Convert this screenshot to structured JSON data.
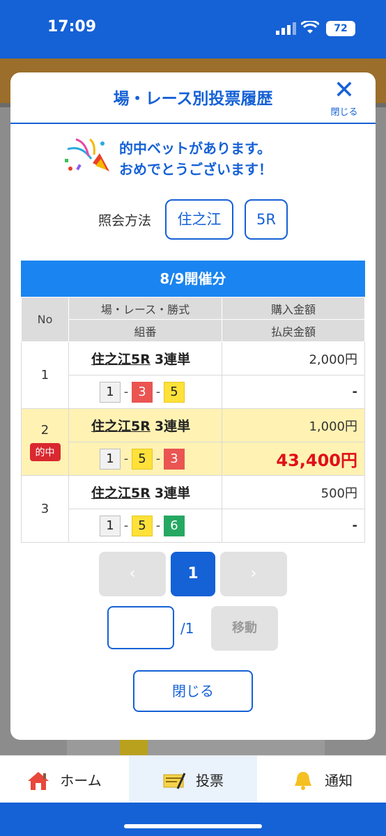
{
  "status_bar": {
    "time": "17:09",
    "battery": "72"
  },
  "modal": {
    "title": "場・レース別投票履歴",
    "close_icon_label": "閉じる",
    "congrats_line1": "的中ベットがあります。",
    "congrats_line2": "おめでとうございます！",
    "query_label": "照会方法",
    "venue_chip": "住之江",
    "race_chip": "5R",
    "date_header": "8/9開催分",
    "table": {
      "headers": {
        "no": "No",
        "race": "場・レース・勝式",
        "combo": "組番",
        "purchase": "購入金額",
        "payout": "払戻金額"
      },
      "rows": [
        {
          "no": "1",
          "race": "住之江5R",
          "bet_type": "3連単",
          "combo": [
            "1",
            "3",
            "5"
          ],
          "amount": "2,000円",
          "payout": "-",
          "hit": false
        },
        {
          "no": "2",
          "race": "住之江5R",
          "bet_type": "3連単",
          "combo": [
            "1",
            "5",
            "3"
          ],
          "amount": "1,000円",
          "payout": "43,400円",
          "hit": true,
          "hit_label": "的中"
        },
        {
          "no": "3",
          "race": "住之江5R",
          "bet_type": "3連単",
          "combo": [
            "1",
            "5",
            "6"
          ],
          "amount": "500円",
          "payout": "-",
          "hit": false
        }
      ]
    },
    "pager": {
      "prev": "‹",
      "current": "1",
      "next": "›",
      "total": "/1",
      "move_label": "移動"
    },
    "close_button": "閉じる"
  },
  "tabbar": {
    "home": "ホーム",
    "vote": "投票",
    "notify": "通知"
  },
  "colors": {
    "brand": "#1561d6",
    "header_bar": "#1a84f0",
    "hit_row": "#fff2b3",
    "win_amount": "#e0101a",
    "boat_1": "#f1f1f1",
    "boat_3": "#ea5552",
    "boat_5": "#ffe13a",
    "boat_6": "#26a862"
  }
}
